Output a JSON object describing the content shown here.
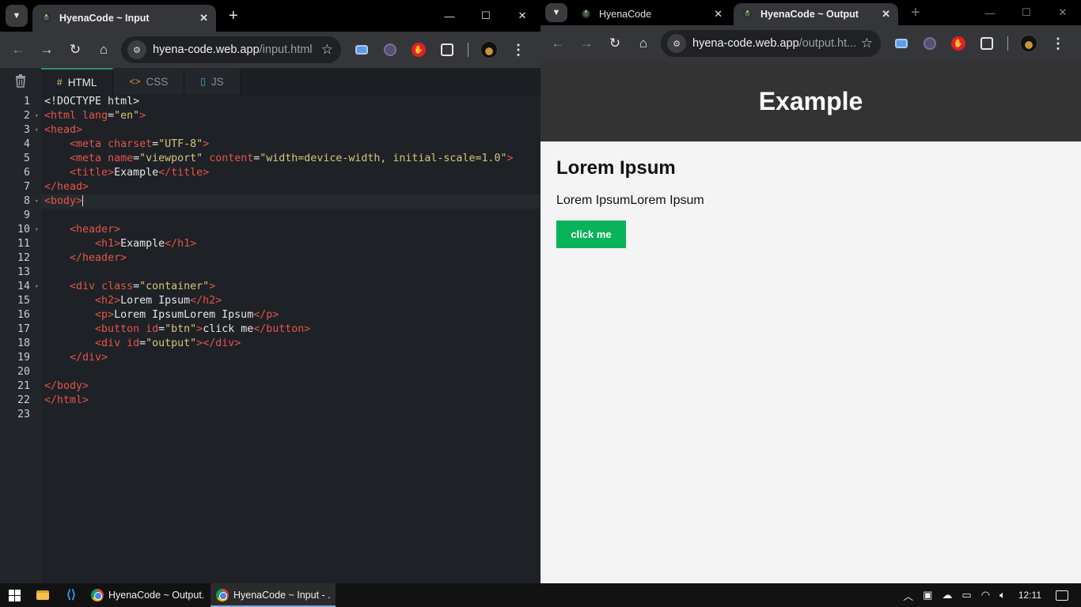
{
  "left_window": {
    "tab_title": "HyenaCode ~ Input",
    "url_host": "hyena-code.web.app",
    "url_path": "/input.html",
    "editor_tabs": [
      {
        "icon": "#",
        "label": "HTML"
      },
      {
        "icon": "<>",
        "label": "CSS"
      },
      {
        "icon": "JS-file",
        "label": "JS"
      }
    ],
    "code_lines": [
      {
        "n": "1",
        "text": "<!DOCTYPE html>"
      },
      {
        "n": "2",
        "text": "<html lang=\"en\">"
      },
      {
        "n": "3",
        "text": "<head>"
      },
      {
        "n": "4",
        "text": "    <meta charset=\"UTF-8\">"
      },
      {
        "n": "5",
        "text": "    <meta name=\"viewport\" content=\"width=device-width, initial-scale=1.0\">"
      },
      {
        "n": "6",
        "text": "    <title>Example</title>"
      },
      {
        "n": "7",
        "text": "</head>"
      },
      {
        "n": "8",
        "text": "<body>"
      },
      {
        "n": "9",
        "text": ""
      },
      {
        "n": "10",
        "text": "    <header>"
      },
      {
        "n": "11",
        "text": "        <h1>Example</h1>"
      },
      {
        "n": "12",
        "text": "    </header>"
      },
      {
        "n": "13",
        "text": ""
      },
      {
        "n": "14",
        "text": "    <div class=\"container\">"
      },
      {
        "n": "15",
        "text": "        <h2>Lorem Ipsum</h2>"
      },
      {
        "n": "16",
        "text": "        <p>Lorem IpsumLorem Ipsum</p>"
      },
      {
        "n": "17",
        "text": "        <button id=\"btn\">click me</button>"
      },
      {
        "n": "18",
        "text": "        <div id=\"output\"></div>"
      },
      {
        "n": "19",
        "text": "    </div>"
      },
      {
        "n": "20",
        "text": ""
      },
      {
        "n": "21",
        "text": "</body>"
      },
      {
        "n": "22",
        "text": "</html>"
      },
      {
        "n": "23",
        "text": ""
      }
    ]
  },
  "right_window": {
    "tabs": [
      {
        "label": "HyenaCode"
      },
      {
        "label": "HyenaCode ~ Output"
      }
    ],
    "url_host": "hyena-code.web.app",
    "url_path": "/output.ht...",
    "page": {
      "header_title": "Example",
      "heading": "Lorem Ipsum",
      "paragraph": "Lorem IpsumLorem Ipsum",
      "button_label": "click me"
    }
  },
  "taskbar": {
    "apps": [
      {
        "label": "HyenaCode ~ Output..."
      },
      {
        "label": "HyenaCode ~ Input - ..."
      }
    ],
    "clock": "12:11"
  },
  "colors": {
    "tag": "#e5534b",
    "attr": "#e5534b",
    "string": "#d5c47b",
    "text": "#e6e6e6",
    "accent_green": "#09b35a",
    "header_bg": "#333333"
  }
}
